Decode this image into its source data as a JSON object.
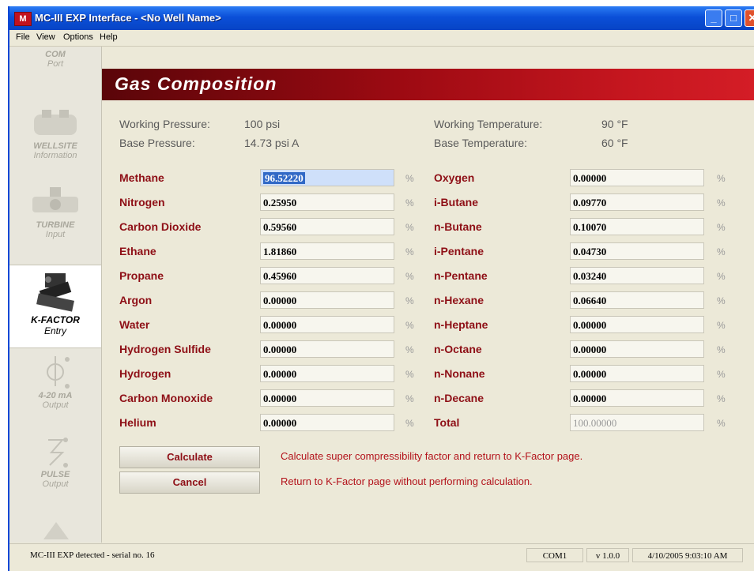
{
  "window": {
    "title": "MC-III EXP Interface - <No Well Name>",
    "app_icon_text": "M",
    "controls": {
      "minimize": "_",
      "maximize": "□",
      "close": "✕"
    }
  },
  "menu": [
    "File",
    "View",
    "Options",
    "Help"
  ],
  "sidebar": {
    "items": [
      {
        "line1": "COM",
        "line2": "Port"
      },
      {
        "line1": "WELLSITE",
        "line2": "Information"
      },
      {
        "line1": "TURBINE",
        "line2": "Input"
      },
      {
        "line1": "K-FACTOR",
        "line2": "Entry"
      },
      {
        "line1": "4-20 mA",
        "line2": "Output"
      },
      {
        "line1": "PULSE",
        "line2": "Output"
      }
    ]
  },
  "header": {
    "title": "Gas Composition"
  },
  "info": {
    "working_pressure_label": "Working Pressure:",
    "working_pressure_value": "100 psi",
    "base_pressure_label": "Base Pressure:",
    "base_pressure_value": "14.73 psi A",
    "working_temperature_label": "Working Temperature:",
    "working_temperature_value": "90 °F",
    "base_temperature_label": "Base Temperature:",
    "base_temperature_value": "60 °F"
  },
  "percent_symbol": "%",
  "left_column": [
    {
      "name": "Methane",
      "value": "96.52220"
    },
    {
      "name": "Nitrogen",
      "value": "0.25950"
    },
    {
      "name": "Carbon Dioxide",
      "value": "0.59560"
    },
    {
      "name": "Ethane",
      "value": "1.81860"
    },
    {
      "name": "Propane",
      "value": "0.45960"
    },
    {
      "name": "Argon",
      "value": "0.00000"
    },
    {
      "name": "Water",
      "value": "0.00000"
    },
    {
      "name": "Hydrogen Sulfide",
      "value": "0.00000"
    },
    {
      "name": "Hydrogen",
      "value": "0.00000"
    },
    {
      "name": "Carbon Monoxide",
      "value": "0.00000"
    },
    {
      "name": "Helium",
      "value": "0.00000"
    }
  ],
  "right_column": [
    {
      "name": "Oxygen",
      "value": "0.00000"
    },
    {
      "name": "i-Butane",
      "value": "0.09770"
    },
    {
      "name": "n-Butane",
      "value": "0.10070"
    },
    {
      "name": "i-Pentane",
      "value": "0.04730"
    },
    {
      "name": "n-Pentane",
      "value": "0.03240"
    },
    {
      "name": "n-Hexane",
      "value": "0.06640"
    },
    {
      "name": "n-Heptane",
      "value": "0.00000"
    },
    {
      "name": "n-Octane",
      "value": "0.00000"
    },
    {
      "name": "n-Nonane",
      "value": "0.00000"
    },
    {
      "name": "n-Decane",
      "value": "0.00000"
    },
    {
      "name": "Total",
      "value": "100.00000"
    }
  ],
  "buttons": {
    "calculate_label": "Calculate",
    "calculate_desc": "Calculate super compressibility factor and return to K-Factor page.",
    "cancel_label": "Cancel",
    "cancel_desc": "Return to K-Factor page without performing calculation."
  },
  "status": {
    "device": "MC-III EXP detected - serial no. 16",
    "port": "COM1",
    "version": "v 1.0.0",
    "datetime": "4/10/2005 9:03:10 AM"
  }
}
